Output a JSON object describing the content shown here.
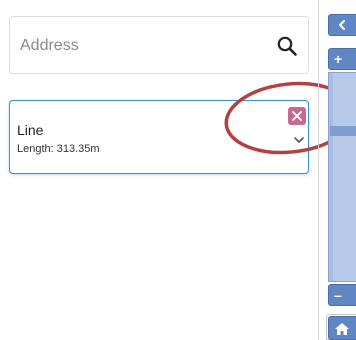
{
  "search": {
    "placeholder": "Address",
    "value": "",
    "icon": "search-icon"
  },
  "measurement": {
    "title": "Line",
    "length_text": "Length: 313.35m",
    "delete_icon": "close-icon",
    "expand_icon": "chevron-down-icon",
    "delete_color": "#c46a93",
    "border_color": "#3c8dd6"
  },
  "annotation": {
    "color": "#b5403f"
  },
  "map_controls": {
    "collapse_icon": "chevron-left-icon",
    "zoom_in_label": "+",
    "zoom_out_label": "–",
    "home_icon": "home-icon",
    "accent": "#5f87c4"
  }
}
